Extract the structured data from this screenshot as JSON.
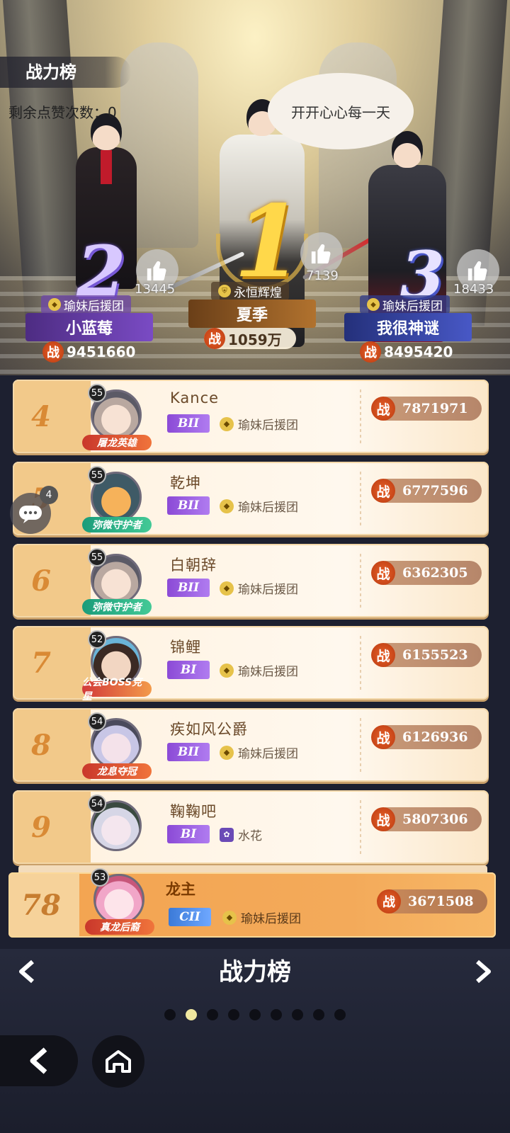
{
  "header": {
    "title": "战力榜",
    "likes_label": "剩余点赞次数：0"
  },
  "bubble": {
    "text": "开开心心每一天"
  },
  "podium": [
    {
      "rank": "2",
      "guild": "瑜妹后援团",
      "name": "小蓝莓",
      "power": "9451660",
      "likes": "13445"
    },
    {
      "rank": "1",
      "guild": "永恒辉煌",
      "name": "夏季",
      "power": "1059万",
      "likes": "7139"
    },
    {
      "rank": "3",
      "guild": "瑜妹后援团",
      "name": "我很神谜",
      "power": "8495420",
      "likes": "18433"
    }
  ],
  "power_glyph": "战",
  "rows": [
    {
      "rank": "4",
      "level": "55",
      "title": "屠龙英雄",
      "name": "Kance",
      "tier": "BII",
      "guild": "瑜妹后援团",
      "power": "7871971"
    },
    {
      "rank": "5",
      "level": "55",
      "title": "弥微守护者",
      "name": "乾坤",
      "tier": "BII",
      "guild": "瑜妹后援团",
      "power": "6777596"
    },
    {
      "rank": "6",
      "level": "55",
      "title": "弥微守护者",
      "name": "白朝辞",
      "tier": "BII",
      "guild": "瑜妹后援团",
      "power": "6362305"
    },
    {
      "rank": "7",
      "level": "52",
      "title": "公会BOSS克星",
      "name": "锦鲤",
      "tier": "BI",
      "guild": "瑜妹后援团",
      "power": "6155523"
    },
    {
      "rank": "8",
      "level": "54",
      "title": "龙息夺冠",
      "name": "疾如风公爵",
      "tier": "BII",
      "guild": "瑜妹后援团",
      "power": "6126936"
    },
    {
      "rank": "9",
      "level": "54",
      "title": "",
      "name": "鞠鞠吧",
      "tier": "BI",
      "guild": "水花",
      "power": "5807306"
    }
  ],
  "self": {
    "rank": "78",
    "level": "53",
    "title": "真龙后裔",
    "name": "龙主",
    "tier": "CII",
    "guild": "瑜妹后援团",
    "power": "3671508"
  },
  "chat": {
    "badge": "4"
  },
  "footer": {
    "title": "战力榜",
    "page_count": 9,
    "active_page": 2
  }
}
